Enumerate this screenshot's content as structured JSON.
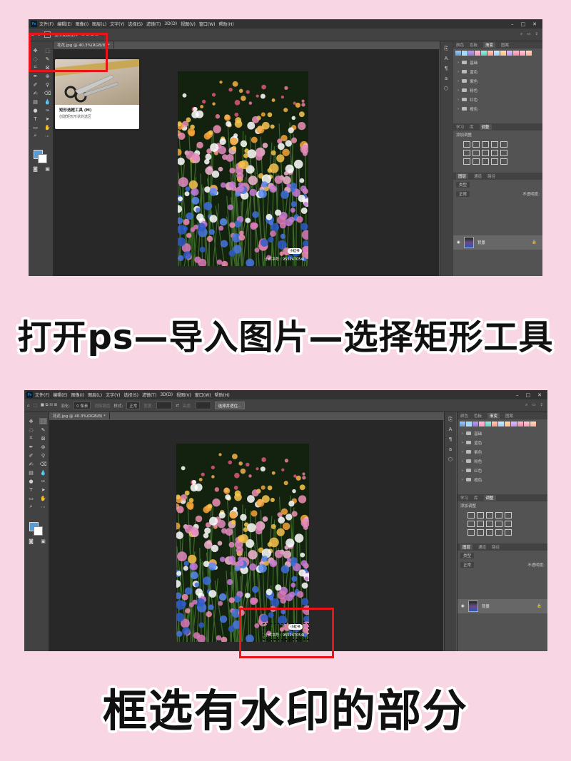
{
  "screen1": {
    "menu": [
      "文件(F)",
      "编辑(E)",
      "图像(I)",
      "图层(L)",
      "文字(Y)",
      "选择(S)",
      "滤镜(T)",
      "3D(D)",
      "视图(V)",
      "窗口(W)",
      "帮助(H)"
    ],
    "options_label": "显示变换控件",
    "doc_tab": "花花.jpg @ 40.3%(RGB/8) *",
    "tooltip_title": "矩形选框工具 (M)",
    "tooltip_desc": "创建矩形形状的选区",
    "watermark_pill": "小红书",
    "watermark_id": "小红书号：955247054I",
    "panel_tabs": [
      "颜色",
      "色板",
      "渐变",
      "图案"
    ],
    "folders": [
      "基础",
      "蓝色",
      "紫色",
      "粉色",
      "红色",
      "橙色"
    ],
    "adj_tabs": [
      "学习",
      "库",
      "调整"
    ],
    "adj_label": "添加调整",
    "layer_tabs": [
      "图层",
      "通道",
      "路径"
    ],
    "layer_kind": "类型",
    "layer_mode": "正常",
    "layer_opacity_label": "不透明度:",
    "layer_name": "背景"
  },
  "screen2": {
    "menu": [
      "文件(F)",
      "编辑(E)",
      "图像(I)",
      "图层(L)",
      "文字(Y)",
      "选择(S)",
      "滤镜(T)",
      "3D(D)",
      "视图(V)",
      "窗口(W)",
      "帮助(H)"
    ],
    "feather_label": "羽化:",
    "feather_value": "0 像素",
    "smooth_label": "消除锯齿",
    "style_label": "样式:",
    "style_value": "正常",
    "width_label": "宽度:",
    "height_label": "高度:",
    "select_mask_btn": "选择并遮住...",
    "doc_tab": "花花.jpg @ 40.3%(RGB/8) *",
    "watermark_pill": "小红书",
    "watermark_id": "小红书号：955247054I",
    "panel_tabs": [
      "颜色",
      "色板",
      "渐变",
      "图案"
    ],
    "folders": [
      "基础",
      "蓝色",
      "紫色",
      "粉色",
      "红色",
      "橙色"
    ],
    "adj_tabs": [
      "学习",
      "库",
      "调整"
    ],
    "adj_label": "添加调整",
    "layer_tabs": [
      "图层",
      "通道",
      "路径"
    ],
    "layer_kind": "类型",
    "layer_mode": "正常",
    "layer_opacity_label": "不透明度:",
    "layer_name": "背景"
  },
  "captions": {
    "step1": "打开ps—导入图片—选择矩形工具",
    "step2": "框选有水印的部分"
  },
  "colors": {
    "page_bg": "#f8d6e4",
    "highlight": "#e8141a",
    "foreground_swatch": "#5b9bd5"
  }
}
